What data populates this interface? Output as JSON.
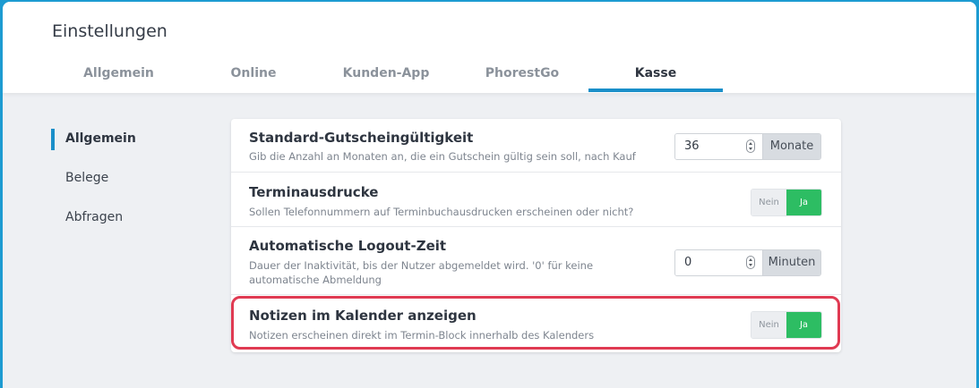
{
  "page": {
    "title": "Einstellungen"
  },
  "tabs": [
    {
      "label": "Allgemein"
    },
    {
      "label": "Online"
    },
    {
      "label": "Kunden-App"
    },
    {
      "label": "PhorestGo"
    },
    {
      "label": "Kasse"
    }
  ],
  "active_tab": "Kasse",
  "sidebar": {
    "items": [
      {
        "label": "Allgemein"
      },
      {
        "label": "Belege"
      },
      {
        "label": "Abfragen"
      }
    ],
    "active": "Allgemein"
  },
  "settings": {
    "voucher": {
      "title": "Standard-Gutscheingültigkeit",
      "description": "Gib die Anzahl an Monaten an, die ein Gutschein gültig sein soll, nach Kauf",
      "value": "36",
      "unit": "Monate"
    },
    "printouts": {
      "title": "Terminausdrucke",
      "description": "Sollen Telefonnummern auf Terminbuchausdrucken erscheinen oder nicht?",
      "no_label": "Nein",
      "yes_label": "Ja",
      "selected": "Ja"
    },
    "logout": {
      "title": "Automatische Logout-Zeit",
      "description": "Dauer der Inaktivität, bis der Nutzer abgemeldet wird. '0' für keine automatische Abmeldung",
      "value": "0",
      "unit": "Minuten"
    },
    "calendar_notes": {
      "title": "Notizen im Kalender anzeigen",
      "description": "Notizen erscheinen direkt im Termin-Block innerhalb des Kalenders",
      "no_label": "Nein",
      "yes_label": "Ja",
      "selected": "Ja"
    }
  },
  "colors": {
    "accent": "#1a8fc9",
    "toggle_on": "#2dbd63",
    "highlight": "#e03a52",
    "frame": "#1d9bd1"
  }
}
